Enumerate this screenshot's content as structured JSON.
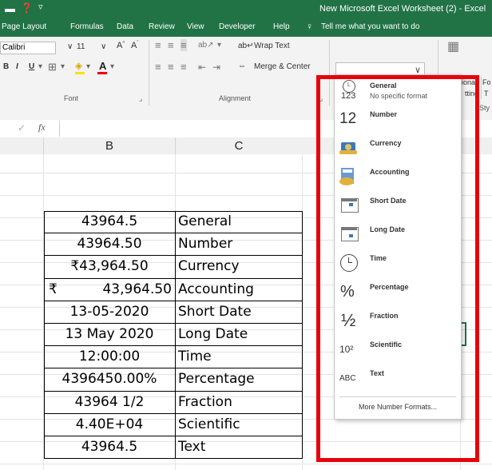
{
  "titlebar": {
    "doc_title": "New Microsoft Excel Worksheet (2)  -  Excel"
  },
  "menu": {
    "tabs": [
      "Page Layout",
      "Formulas",
      "Data",
      "Review",
      "View",
      "Developer",
      "Help"
    ],
    "tell_me": "Tell me what you want to do"
  },
  "ribbon": {
    "font_name": "Calibri",
    "font_size": "11",
    "wrap_text": "Wrap Text",
    "merge_center": "Merge & Center",
    "font_group": "Font",
    "alignment_group": "Alignment",
    "bold": "B",
    "italic": "I",
    "underline": "U",
    "right_partial": [
      "ional",
      "tting",
      "Fo",
      "T",
      "Sty"
    ]
  },
  "formula_bar": {
    "fx": "fx"
  },
  "columns": {
    "b": "B",
    "c": "C"
  },
  "table": {
    "rows": [
      {
        "value": "43964.5",
        "format": "General"
      },
      {
        "value": "43964.50",
        "format": "Number"
      },
      {
        "value": "₹43,964.50",
        "format": "Currency"
      },
      {
        "value_symbol": "₹",
        "value": "43,964.50",
        "format": "Accounting"
      },
      {
        "value": "13-05-2020",
        "format": "Short Date"
      },
      {
        "value": "13 May 2020",
        "format": "Long Date"
      },
      {
        "value": "12:00:00",
        "format": "Time"
      },
      {
        "value": "4396450.00%",
        "format": "Percentage"
      },
      {
        "value": "43964 1/2",
        "format": "Fraction"
      },
      {
        "value": "4.40E+04",
        "format": "Scientific"
      },
      {
        "value": "43964.5",
        "format": "Text"
      }
    ]
  },
  "dropdown": {
    "items": [
      {
        "label": "General",
        "sub": "No specific format",
        "icon": "general-clock-123-icon",
        "glyph": "123"
      },
      {
        "label": "Number",
        "icon": "number-12-icon",
        "glyph": "12"
      },
      {
        "label": "Currency",
        "icon": "currency-icon"
      },
      {
        "label": "Accounting",
        "icon": "accounting-icon"
      },
      {
        "label": "Short Date",
        "icon": "calendar-short-icon"
      },
      {
        "label": "Long Date",
        "icon": "calendar-long-icon"
      },
      {
        "label": "Time",
        "icon": "clock-icon"
      },
      {
        "label": "Percentage",
        "icon": "percent-icon",
        "glyph": "%"
      },
      {
        "label": "Fraction",
        "icon": "fraction-icon",
        "glyph": "½"
      },
      {
        "label": "Scientific",
        "icon": "scientific-icon",
        "glyph": "10²"
      },
      {
        "label": "Text",
        "icon": "abc-icon",
        "glyph": "ABC"
      }
    ],
    "more": "More Number Formats..."
  },
  "colors": {
    "excel_green": "#217346",
    "highlight_red": "#e8000b"
  }
}
